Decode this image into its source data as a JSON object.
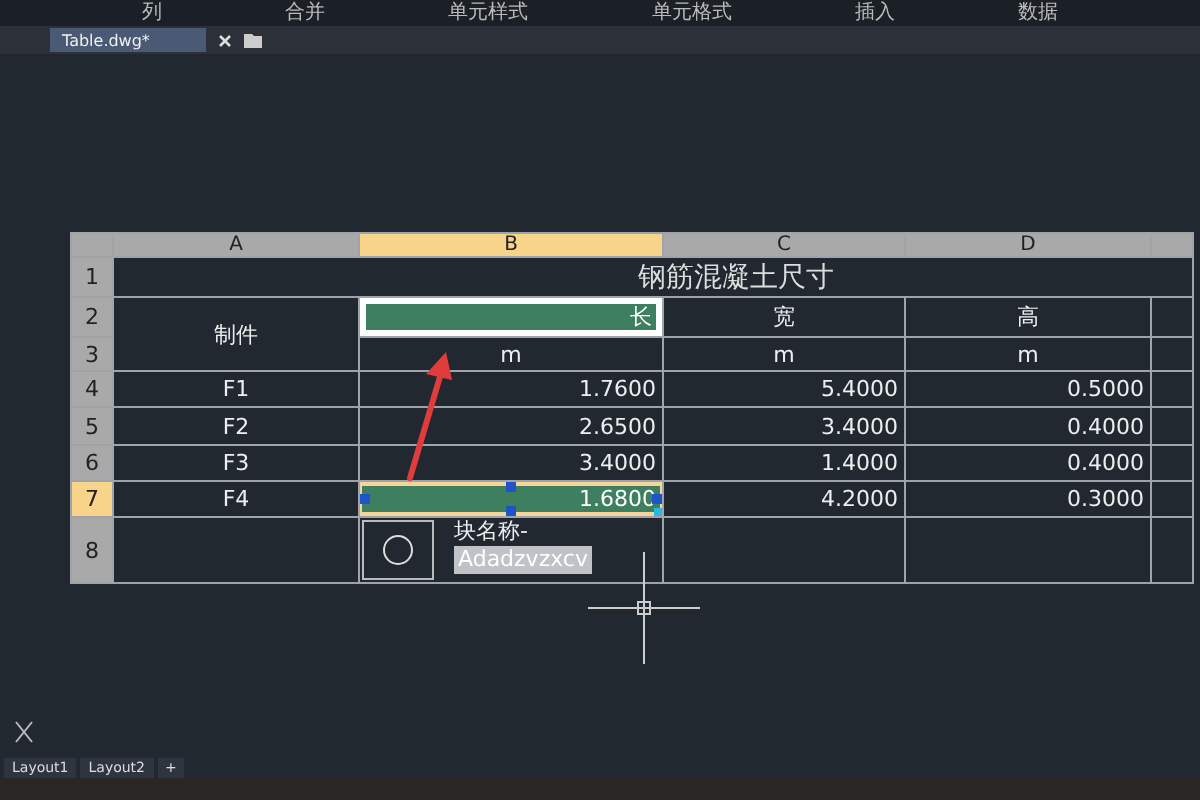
{
  "ribbon": [
    "列",
    "合并",
    "单元样式",
    "单元格式",
    "插入",
    "数据"
  ],
  "file_tab": {
    "title": "Table.dwg*"
  },
  "table": {
    "column_headers": [
      {
        "label": "A",
        "selected": false
      },
      {
        "label": "B",
        "selected": true
      },
      {
        "label": "C",
        "selected": false
      },
      {
        "label": "D",
        "selected": false
      },
      {
        "selected": false
      }
    ],
    "row_headers": [
      {
        "label": "1",
        "selected": false
      },
      {
        "label": "2",
        "selected": false
      },
      {
        "label": "3",
        "selected": false
      },
      {
        "label": "4",
        "selected": false
      },
      {
        "label": "5",
        "selected": false
      },
      {
        "label": "6",
        "selected": false
      },
      {
        "label": "7",
        "selected": true
      },
      {
        "label": "8",
        "selected": false
      }
    ],
    "title": "钢筋混凝土尺寸",
    "part_header": "制件",
    "headers": [
      {
        "text": "长",
        "selected": true
      },
      {
        "text": "宽",
        "selected": false
      },
      {
        "text": "高",
        "selected": false
      }
    ],
    "units": [
      "m",
      "m",
      "m"
    ],
    "rows": [
      {
        "part": "F1",
        "values": [
          {
            "text": "1.7600",
            "selected": false
          },
          {
            "text": "5.4000",
            "selected": false
          },
          {
            "text": "0.5000",
            "selected": false
          }
        ]
      },
      {
        "part": "F2",
        "values": [
          {
            "text": "2.6500",
            "selected": false
          },
          {
            "text": "3.4000",
            "selected": false
          },
          {
            "text": "0.4000",
            "selected": false
          }
        ]
      },
      {
        "part": "F3",
        "values": [
          {
            "text": "3.4000",
            "selected": false
          },
          {
            "text": "1.4000",
            "selected": false
          },
          {
            "text": "0.4000",
            "selected": false
          }
        ]
      },
      {
        "part": "F4",
        "values": [
          {
            "text": "1.6800",
            "selected": true
          },
          {
            "text": "4.2000",
            "selected": false
          },
          {
            "text": "0.3000",
            "selected": false
          }
        ]
      }
    ],
    "block": {
      "label": "块名称-",
      "value": "Adadzvzxcv"
    }
  },
  "layout_tabs": [
    "Layout1",
    "Layout2",
    "+"
  ]
}
